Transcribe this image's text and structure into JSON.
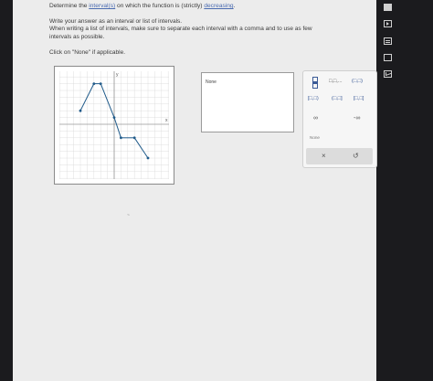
{
  "question": {
    "prefix": "Determine the ",
    "link": "interval(s)",
    "middle": " on which the function is (strictly) ",
    "link2": "decreasing",
    "suffix": "."
  },
  "instructions": [
    "Write your answer as an interval or list of intervals.",
    "When writing a list of intervals, make sure to separate each interval with a comma and to use as few",
    "intervals as possible.",
    "Click on \"None\" if applicable."
  ],
  "graph": {
    "y_axis_label": "y",
    "x_axis_label": "x",
    "function_points": [
      [
        -5,
        2
      ],
      [
        -3,
        6
      ],
      [
        -2,
        6
      ],
      [
        0,
        1
      ],
      [
        1,
        -2
      ],
      [
        3,
        -2
      ],
      [
        5,
        -5
      ]
    ],
    "point_color": "#1f5a8a"
  },
  "answer": {
    "value": "None"
  },
  "keypad": {
    "ellipsis": "□,□,...",
    "open_open": "(□,□)",
    "closed_open": "[□,□)",
    "open_closed": "(□,□]",
    "closed_closed": "[□,□]",
    "infinity": "∞",
    "neg_infinity": "-∞",
    "none": "None",
    "clear": "×",
    "undo": "↺"
  },
  "colors": {
    "accent": "#3a5a96",
    "background": "#ececec"
  },
  "stray_mark": "~"
}
